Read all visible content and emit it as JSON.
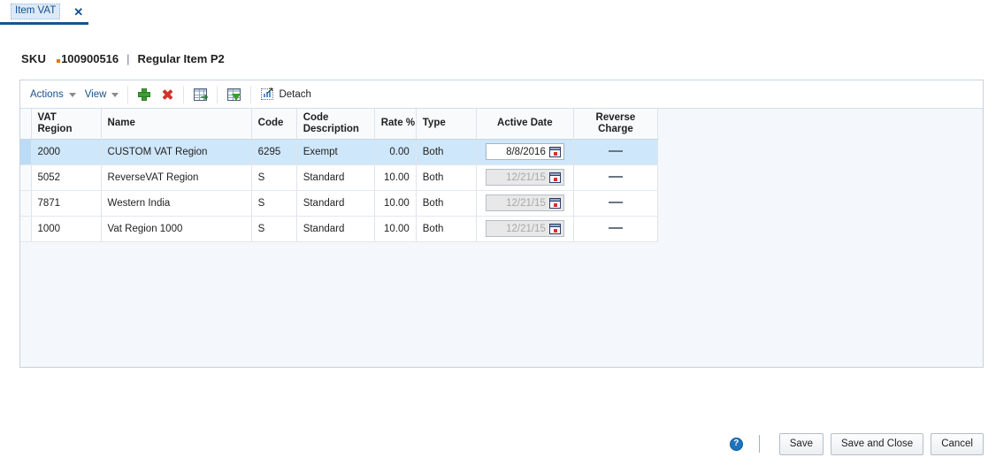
{
  "tab": {
    "label": "Item VAT",
    "close_label": "✕"
  },
  "header": {
    "sku_label": "SKU",
    "sku_value": "100900516",
    "separator": "|",
    "description": "Regular Item P2"
  },
  "toolbar": {
    "actions_label": "Actions",
    "view_label": "View",
    "add_icon": "plus-icon",
    "delete_icon": "delete-x-icon",
    "export_icon": "export-to-excel-icon",
    "query_icon": "query-by-example-icon",
    "detach_label": "Detach",
    "detach_icon": "detach-icon"
  },
  "table": {
    "columns": [
      {
        "key": "vat_region",
        "label": "VAT\nRegion",
        "align": "left"
      },
      {
        "key": "name",
        "label": "Name",
        "align": "left"
      },
      {
        "key": "code",
        "label": "Code",
        "align": "left"
      },
      {
        "key": "code_description",
        "label": "Code\nDescription",
        "align": "left"
      },
      {
        "key": "rate",
        "label": "Rate %",
        "align": "right"
      },
      {
        "key": "type",
        "label": "Type",
        "align": "left"
      },
      {
        "key": "active_date",
        "label": "Active Date",
        "align": "center"
      },
      {
        "key": "reverse_charge",
        "label": "Reverse\nCharge",
        "align": "center"
      }
    ],
    "column_labels": {
      "vat_region_line1": "VAT",
      "vat_region_line2": "Region",
      "name": "Name",
      "code": "Code",
      "code_description_line1": "Code",
      "code_description_line2": "Description",
      "rate": "Rate %",
      "type": "Type",
      "active_date": "Active Date",
      "reverse_charge_line1": "Reverse",
      "reverse_charge_line2": "Charge"
    },
    "rows": [
      {
        "vat_region": "2000",
        "name": "CUSTOM VAT Region",
        "code": "6295",
        "code_description": "Exempt",
        "rate": "0.00",
        "type": "Both",
        "active_date": "8/8/2016",
        "date_enabled": true,
        "reverse_charge": "",
        "selected": true
      },
      {
        "vat_region": "5052",
        "name": "ReverseVAT Region",
        "code": "S",
        "code_description": "Standard",
        "rate": "10.00",
        "type": "Both",
        "active_date": "12/21/15",
        "date_enabled": false,
        "reverse_charge": "",
        "selected": false
      },
      {
        "vat_region": "7871",
        "name": "Western India",
        "code": "S",
        "code_description": "Standard",
        "rate": "10.00",
        "type": "Both",
        "active_date": "12/21/15",
        "date_enabled": false,
        "reverse_charge": "",
        "selected": false
      },
      {
        "vat_region": "1000",
        "name": "Vat Region 1000",
        "code": "S",
        "code_description": "Standard",
        "rate": "10.00",
        "type": "Both",
        "active_date": "12/21/15",
        "date_enabled": false,
        "reverse_charge": "",
        "selected": false
      }
    ]
  },
  "footer": {
    "help_icon": "help-question-icon",
    "help_glyph": "?",
    "save_label": "Save",
    "save_and_close_label": "Save and Close",
    "cancel_label": "Cancel"
  },
  "colors": {
    "accent_blue": "#17548f",
    "link_blue": "#1c4f86",
    "selected_row": "#cfe7fa",
    "panel_bg": "#f4f7fb",
    "required_marker": "#e8740c",
    "add_green": "#3f9c35",
    "delete_red": "#d0342c"
  }
}
